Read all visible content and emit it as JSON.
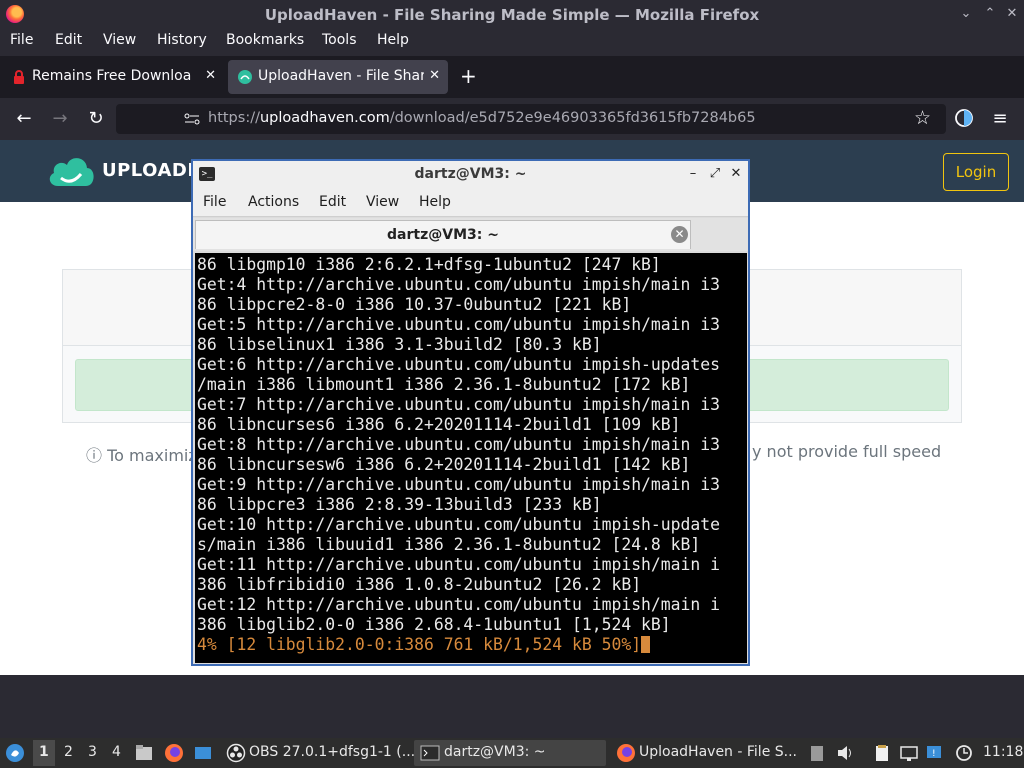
{
  "firefox": {
    "window_title": "UploadHaven - File Sharing Made Simple — Mozilla Firefox",
    "menu": [
      "File",
      "Edit",
      "View",
      "History",
      "Bookmarks",
      "Tools",
      "Help"
    ],
    "tabs": [
      {
        "label": "Remains Free Download (",
        "active": false
      },
      {
        "label": "UploadHaven - File Sharin",
        "active": true
      }
    ],
    "url_base": "https://",
    "url_host": "uploadhaven.com",
    "url_path": "/download/e5d752e9e46903365fd3615fb7284b65"
  },
  "page": {
    "brand": "UPLOADHA",
    "login": "Login",
    "notice_left": "To maximiz",
    "notice_right": "y not provide full speed",
    "colors": {
      "header": "#2c3e50",
      "login_border": "#f1c40f",
      "alert_bg": "#d4edda"
    }
  },
  "terminal": {
    "window_title": "dartz@VM3: ~",
    "menu": [
      "File",
      "Actions",
      "Edit",
      "View",
      "Help"
    ],
    "tab_label": "dartz@VM3: ~",
    "lines": [
      "86 libgmp10 i386 2:6.2.1+dfsg-1ubuntu2 [247 kB]",
      "Get:4 http://archive.ubuntu.com/ubuntu impish/main i3",
      "86 libpcre2-8-0 i386 10.37-0ubuntu2 [221 kB]",
      "Get:5 http://archive.ubuntu.com/ubuntu impish/main i3",
      "86 libselinux1 i386 3.1-3build2 [80.3 kB]",
      "Get:6 http://archive.ubuntu.com/ubuntu impish-updates",
      "/main i386 libmount1 i386 2.36.1-8ubuntu2 [172 kB]",
      "Get:7 http://archive.ubuntu.com/ubuntu impish/main i3",
      "86 libncurses6 i386 6.2+20201114-2build1 [109 kB]",
      "Get:8 http://archive.ubuntu.com/ubuntu impish/main i3",
      "86 libncursesw6 i386 6.2+20201114-2build1 [142 kB]",
      "Get:9 http://archive.ubuntu.com/ubuntu impish/main i3",
      "86 libpcre3 i386 2:8.39-13build3 [233 kB]",
      "Get:10 http://archive.ubuntu.com/ubuntu impish-update",
      "s/main i386 libuuid1 i386 2.36.1-8ubuntu2 [24.8 kB]",
      "Get:11 http://archive.ubuntu.com/ubuntu impish/main i",
      "386 libfribidi0 i386 1.0.8-2ubuntu2 [26.2 kB]",
      "Get:12 http://archive.ubuntu.com/ubuntu impish/main i",
      "386 libglib2.0-0 i386 2.68.4-1ubuntu1 [1,524 kB]"
    ],
    "progress_line": "4% [12 libglib2.0-0:i386 761 kB/1,524 kB 50%]",
    "progress_color": "#d78a3c"
  },
  "taskbar": {
    "workspaces": [
      "1",
      "2",
      "3",
      "4"
    ],
    "active_workspace": "1",
    "tasks": [
      {
        "label": "OBS 27.0.1+dfsg1-1 (...",
        "icon": "obs-icon"
      },
      {
        "label": "dartz@VM3: ~",
        "icon": "terminal-icon"
      },
      {
        "label": "UploadHaven - File S...",
        "icon": "firefox-icon"
      }
    ],
    "clock": "11:18"
  }
}
